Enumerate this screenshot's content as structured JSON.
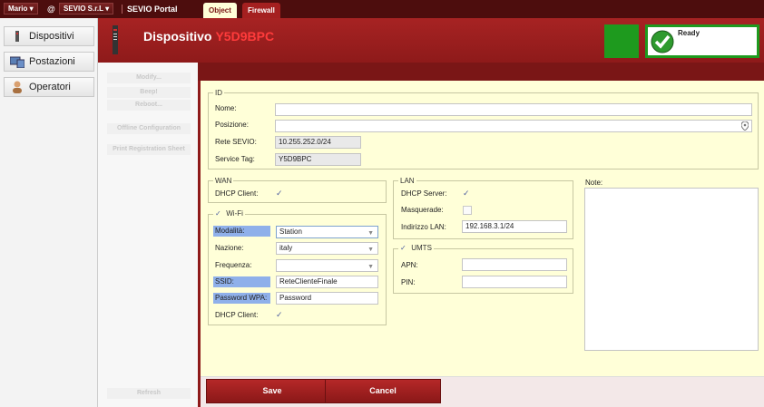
{
  "topbar": {
    "user": "Mario",
    "at": "@",
    "company": "SEVIO S.r.L",
    "portal": "SEVIO Portal"
  },
  "sidebar": {
    "items": [
      {
        "label": "Dispositivi",
        "icon": "device-icon"
      },
      {
        "label": "Postazioni",
        "icon": "workstation-icon"
      },
      {
        "label": "Operatori",
        "icon": "user-icon"
      }
    ]
  },
  "actions": {
    "items": [
      "Modify...",
      "Beep!",
      "Reboot...",
      "Offline Configuration",
      "Print Registration Sheet"
    ],
    "refresh": "Refresh"
  },
  "header": {
    "title": "Dispositivo",
    "device_id": "Y5D9BPC",
    "status": "Ready",
    "colors": {
      "header": "#9b1f1f",
      "status_green": "#1e9a1e"
    }
  },
  "tabs": [
    {
      "label": "Object",
      "active": true
    },
    {
      "label": "Firewall",
      "active": false
    }
  ],
  "id_section": {
    "legend": "ID",
    "nome_label": "Nome:",
    "nome_value": "",
    "posizione_label": "Posizione:",
    "posizione_value": "",
    "rete_label": "Rete SEVIO:",
    "rete_value": "10.255.252.0/24",
    "tag_label": "Service Tag:",
    "tag_value": "Y5D9BPC"
  },
  "wan": {
    "legend": "WAN",
    "dhcp_label": "DHCP Client:",
    "dhcp_checked": true
  },
  "wifi": {
    "legend": "Wi-Fi",
    "enabled": true,
    "modalita_label": "Modalità:",
    "modalita_value": "Station",
    "nazione_label": "Nazione:",
    "nazione_value": "italy",
    "frequenza_label": "Frequenza:",
    "frequenza_value": "",
    "ssid_label": "SSID:",
    "ssid_value": "ReteClienteFinale",
    "password_label": "Password WPA:",
    "password_value": "Password",
    "dhcp_label": "DHCP Client:",
    "dhcp_checked": true
  },
  "lan": {
    "legend": "LAN",
    "dhcp_server_label": "DHCP Server:",
    "dhcp_server_checked": true,
    "masq_label": "Masquerade:",
    "masq_checked": false,
    "ip_label": "Indirizzo LAN:",
    "ip_value": "192.168.3.1/24"
  },
  "umts": {
    "legend": "UMTS",
    "enabled": true,
    "apn_label": "APN:",
    "apn_value": "",
    "pin_label": "PIN:",
    "pin_value": ""
  },
  "note": {
    "label": "Note:",
    "value": ""
  },
  "footer": {
    "save": "Save",
    "cancel": "Cancel"
  }
}
